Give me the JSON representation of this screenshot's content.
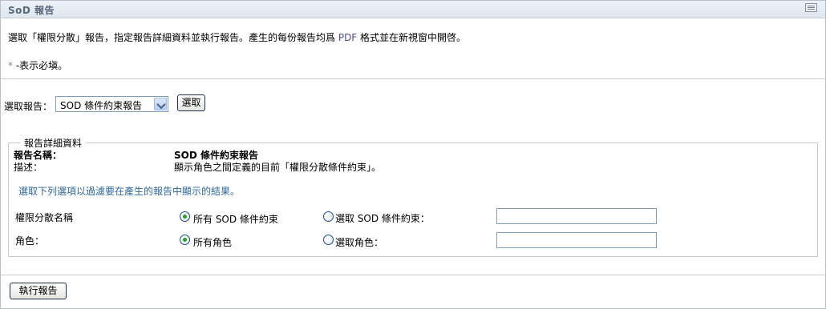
{
  "window": {
    "title": "SoD 報告",
    "collapse_icon": "collapse-icon"
  },
  "intro": {
    "instruction_before": "選取「權限分散」報告，指定報告詳細資料並執行報告。產生的每份報告均爲 ",
    "instruction_pdf": "PDF",
    "instruction_after": " 格式並在新視窗中開啓。",
    "required_star": "*",
    "required_text": " -表示必塡。"
  },
  "report_select": {
    "label": "選取報告：",
    "selected": "SOD 條件約束報告",
    "choose_button": "選取"
  },
  "details": {
    "legend": "報告詳細資料",
    "name_label": "報告名稱：",
    "name_value": "SOD 條件約束報告",
    "desc_label": "描述：",
    "desc_value": "顯示角色之間定義的目前「權限分散條件約束」。",
    "filter_note": "選取下列選項以過濾要在產生的報告中顯示的結果。",
    "rows": [
      {
        "label": "權限分散名稱",
        "option_all": "所有 SOD 條件約束",
        "option_select": "選取 SOD 條件約束：",
        "selected": "all",
        "input_value": ""
      },
      {
        "label": "角色：",
        "option_all": "所有角色",
        "option_select": "選取角色：",
        "selected": "all",
        "input_value": ""
      }
    ]
  },
  "footer": {
    "run_button": "執行報告"
  },
  "colors": {
    "title_text": "#58677a",
    "pdf_link": "#4a4f9e",
    "filter_note": "#2f68a0",
    "radio_dot": "#21a121",
    "border": "#7f9db9"
  }
}
